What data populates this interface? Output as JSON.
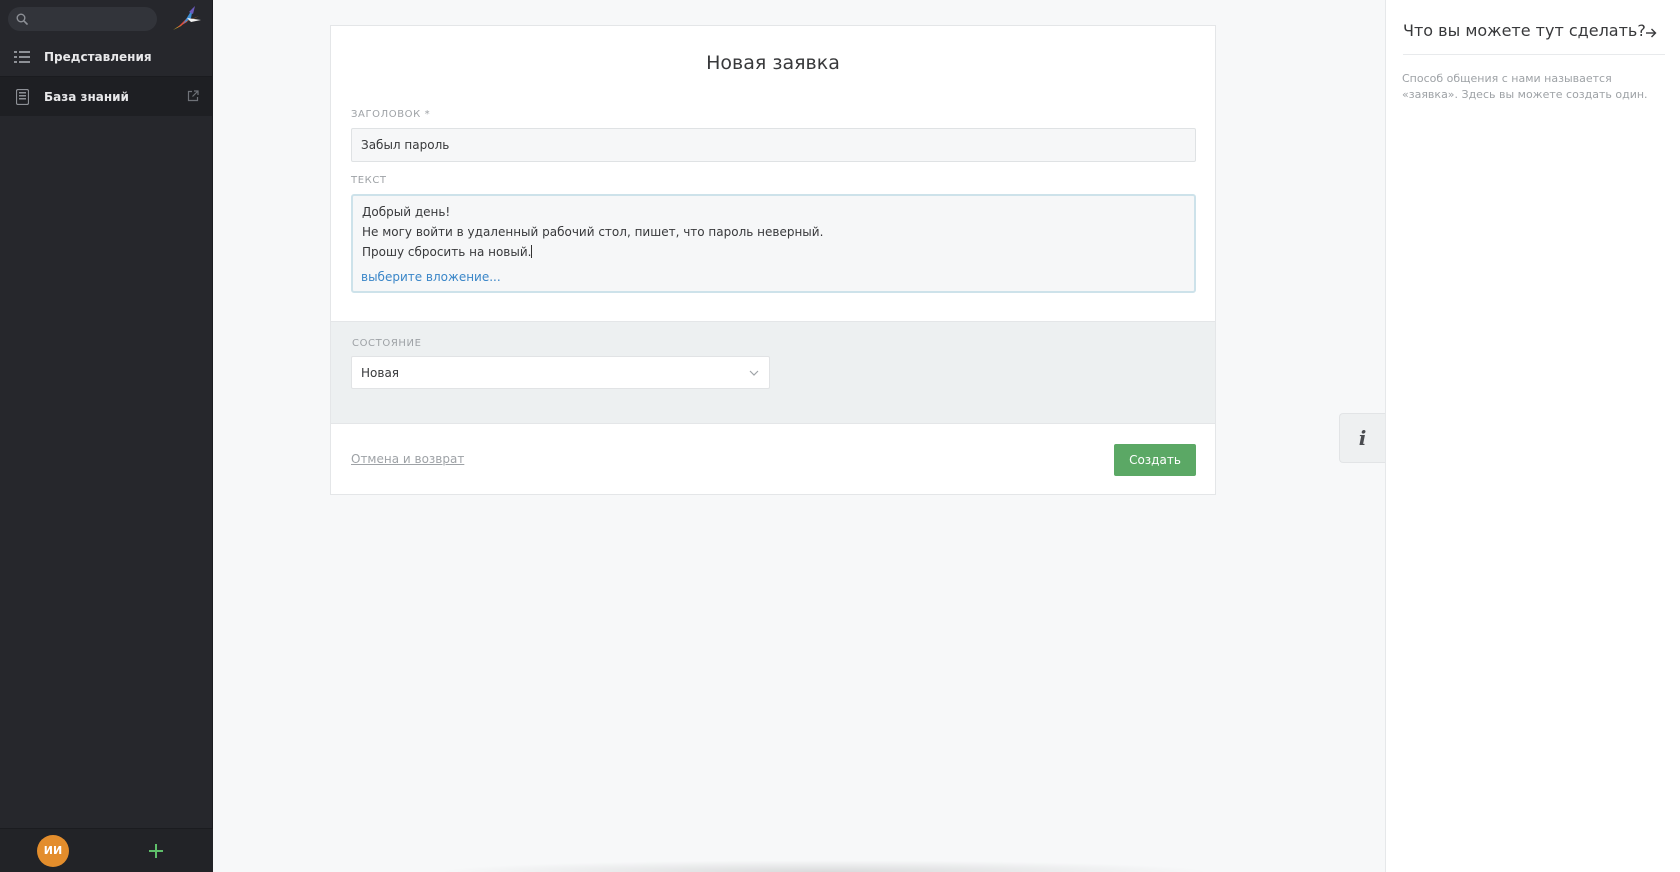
{
  "sidebar": {
    "search": {
      "placeholder": "",
      "value": ""
    },
    "logo_icon": "bird-logo-icon",
    "items": [
      {
        "label": "Представления",
        "icon": "list-icon"
      },
      {
        "label": "База знаний",
        "icon": "book-icon",
        "trailing_icon": "external-link-icon"
      }
    ],
    "avatar_initials": "ИИ",
    "add_label": "+"
  },
  "ticket": {
    "title": "Новая заявка",
    "title_field": {
      "label": "ЗАГОЛОВОК *",
      "value": "Забыл пароль"
    },
    "text_field": {
      "label": "ТЕКСТ",
      "lines": [
        "Добрый день!",
        "Не могу войти в удаленный рабочий стол, пишет, что пароль неверный.",
        "Прошу сбросить на новый."
      ],
      "attachment_link": "выберите вложение..."
    },
    "state_field": {
      "label": "СОСТОЯНИЕ",
      "value": "Новая"
    },
    "cancel_label": "Отмена и возврат",
    "create_label": "Создать"
  },
  "info_toggle": {
    "label": "i"
  },
  "right_panel": {
    "title": "Что вы можете тут сделать?",
    "text": "Способ общения с нами называется «заявка». Здесь вы можете создать один."
  },
  "colors": {
    "sidebar_bg": "#26272c",
    "accent_green": "#5ba865",
    "link_blue": "#3a86c8",
    "avatar_orange": "#e38d2c"
  }
}
